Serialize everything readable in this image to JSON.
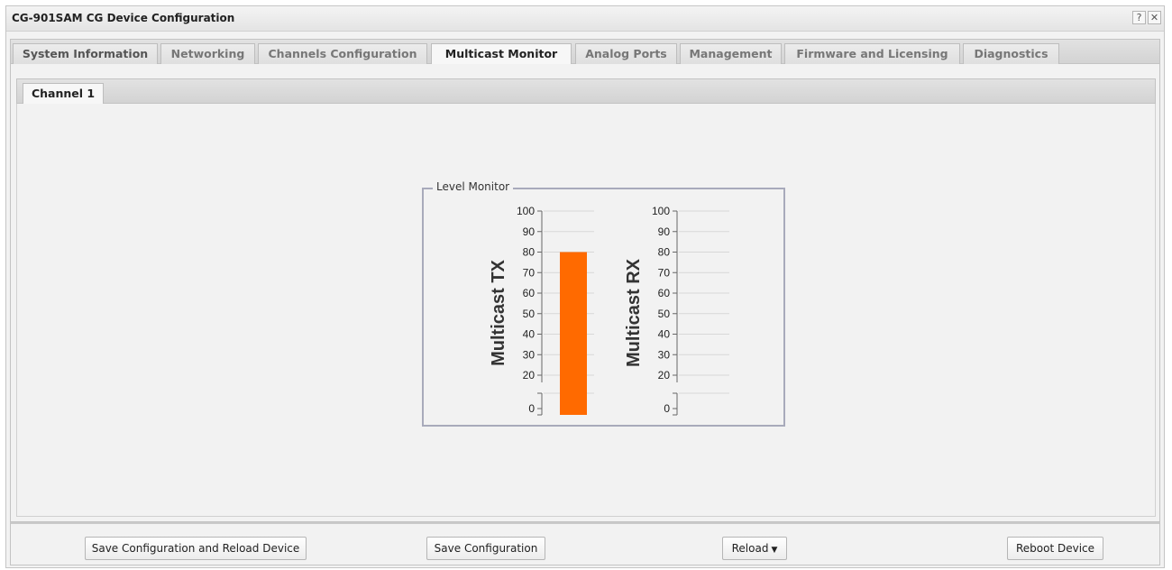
{
  "window": {
    "title": "CG-901SAM CG Device Configuration",
    "help_label": "?",
    "close_label": "✕"
  },
  "tabs": [
    {
      "label": "System Information",
      "active": false
    },
    {
      "label": "Networking",
      "active": false
    },
    {
      "label": "Channels Configuration",
      "active": false
    },
    {
      "label": "Multicast Monitor",
      "active": true
    },
    {
      "label": "Analog Ports",
      "active": false
    },
    {
      "label": "Management",
      "active": false
    },
    {
      "label": "Firmware and Licensing",
      "active": false
    },
    {
      "label": "Diagnostics",
      "active": false
    }
  ],
  "subtabs": [
    {
      "label": "Channel 1",
      "active": true
    }
  ],
  "level_monitor": {
    "legend": "Level Monitor"
  },
  "chart_data": [
    {
      "type": "bar",
      "title": "",
      "ylabel": "Multicast TX",
      "ylim": [
        0,
        100
      ],
      "yticks": [
        "100",
        "90",
        "80",
        "70",
        "60",
        "50",
        "40",
        "30",
        "20",
        "0"
      ],
      "values": [
        80
      ],
      "bar_color": "#ff6a00"
    },
    {
      "type": "bar",
      "title": "",
      "ylabel": "Multicast RX",
      "ylim": [
        0,
        100
      ],
      "yticks": [
        "100",
        "90",
        "80",
        "70",
        "60",
        "50",
        "40",
        "30",
        "20",
        "0"
      ],
      "values": [
        0
      ],
      "bar_color": "#ff6a00"
    }
  ],
  "footer": {
    "save_reload_label": "Save Configuration and Reload Device",
    "save_label": "Save Configuration",
    "reload_label": "Reload",
    "reboot_label": "Reboot Device"
  }
}
